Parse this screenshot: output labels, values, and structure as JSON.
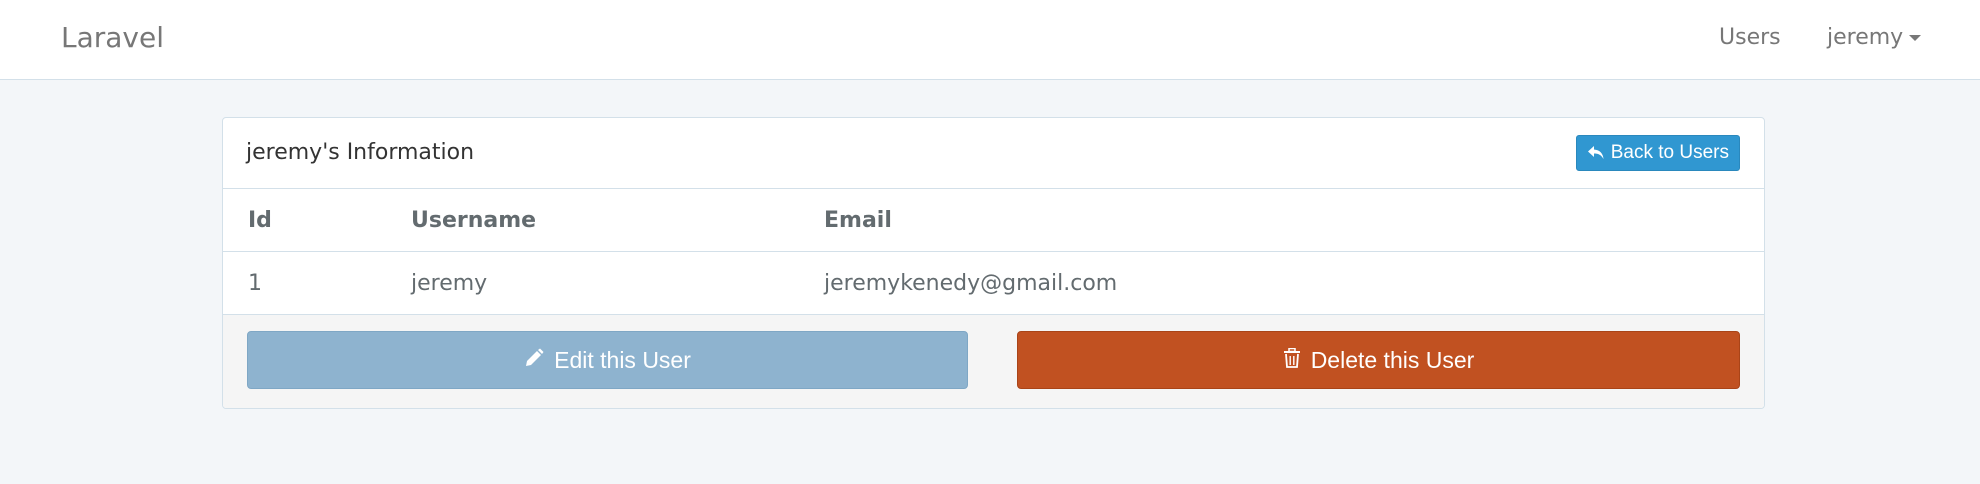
{
  "navbar": {
    "brand": "Laravel",
    "users_link": "Users",
    "user_menu": "jeremy"
  },
  "panel": {
    "title": "jeremy's Information",
    "back_button": "Back to Users"
  },
  "table": {
    "headers": [
      "Id",
      "Username",
      "Email"
    ],
    "rows": [
      [
        "1",
        "jeremy",
        "jeremykenedy@gmail.com"
      ]
    ]
  },
  "actions": {
    "edit_label": "Edit this User",
    "delete_label": "Delete this User"
  },
  "colors": {
    "primary": "#3097d1",
    "edit": "#8eb3cf",
    "delete": "#c15121",
    "background": "#f3f6f9"
  },
  "icons": {
    "back": "reply-icon",
    "edit": "pencil-icon",
    "delete": "trash-icon",
    "dropdown": "caret-down-icon"
  }
}
